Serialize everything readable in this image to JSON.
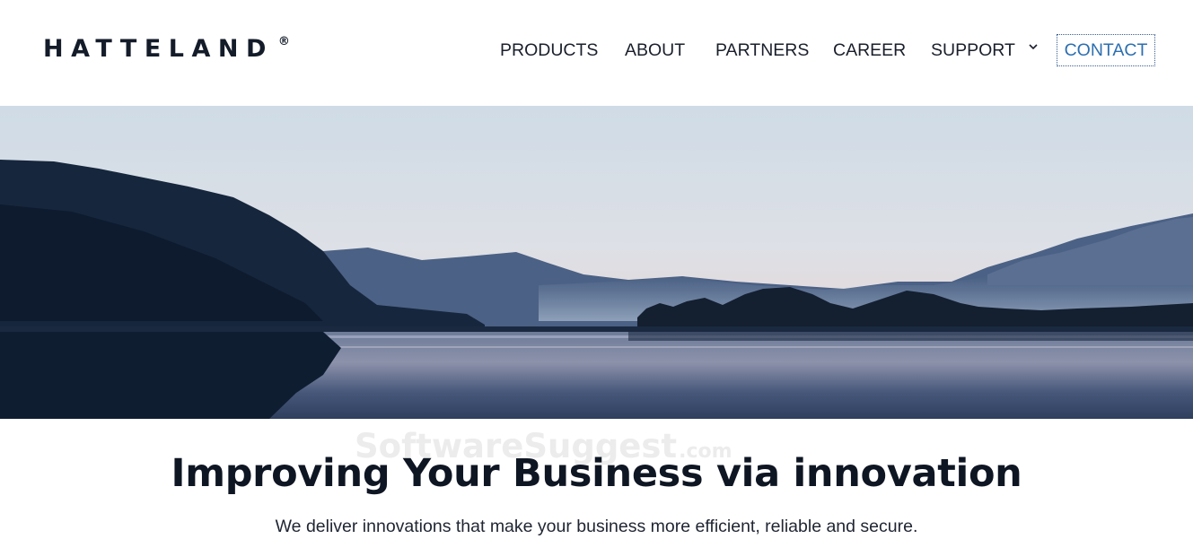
{
  "brand": {
    "name": "HATTELAND",
    "registered_mark": "®"
  },
  "nav": {
    "items": [
      "PRODUCTS",
      "ABOUT",
      "PARTNERS",
      "CAREER",
      "SUPPORT"
    ],
    "dropdown_icon": "chevron-down-icon",
    "contact_label": "CONTACT"
  },
  "hero": {
    "image": "lake-mountains-dusk"
  },
  "content": {
    "headline": "Improving Your Business via innovation",
    "subline": "We deliver innovations that make your business more efficient, reliable and secure."
  },
  "watermark": {
    "text": "SoftwareSuggest",
    "suffix": ".com"
  },
  "colors": {
    "text": "#141c2a",
    "contact": "#2c6fb0",
    "background": "#ffffff"
  }
}
